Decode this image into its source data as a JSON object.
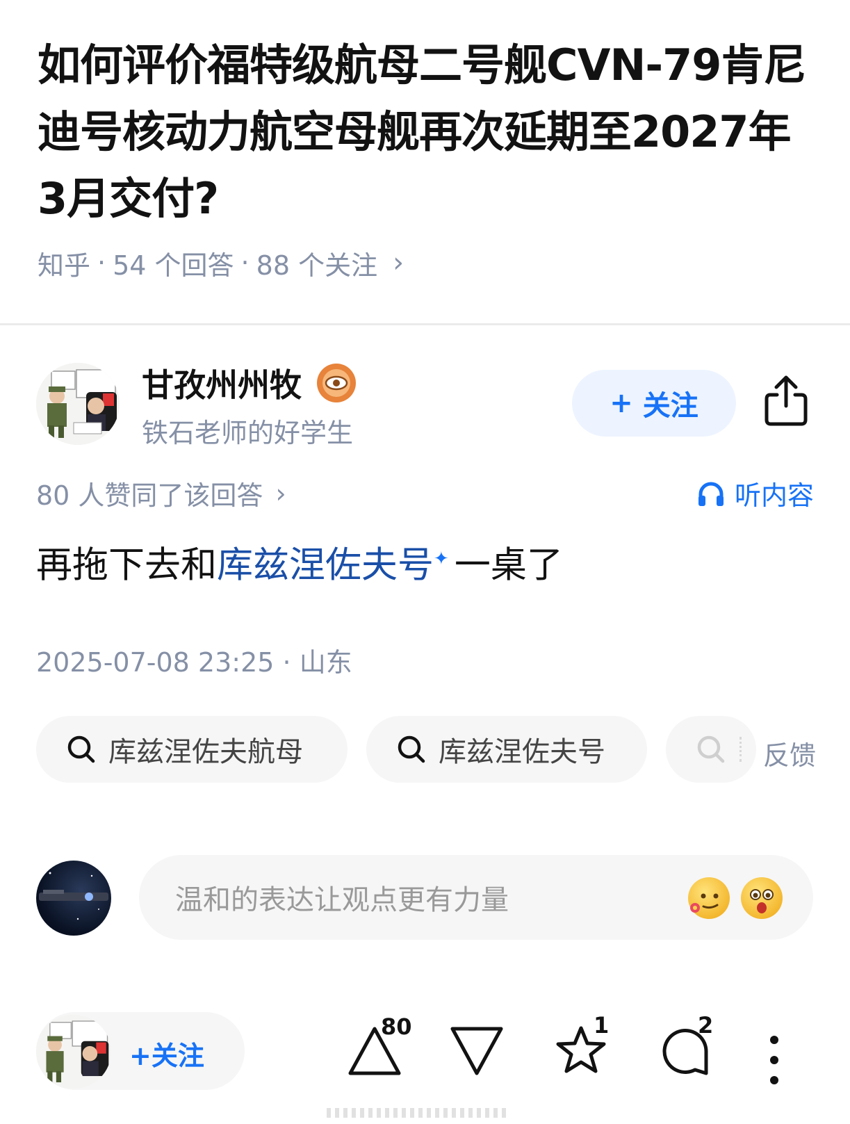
{
  "question": {
    "title": "如何评价福特级航母二号舰CVN-79肯尼迪号核动力航空母舰再次延期至2027年3月交付?",
    "meta": {
      "source": "知乎",
      "answers": "54 个回答",
      "followers": "88 个关注",
      "separator": "·",
      "chevron": "›"
    }
  },
  "author": {
    "name": "甘孜州州牧",
    "subtitle": "铁石老师的好学生",
    "follow_label": "关注",
    "follow_plus": "+",
    "avatar_icon": "avatar-cartoon-soldier"
  },
  "answer": {
    "votes_text": "80 人赞同了该回答",
    "votes_chevron": "›",
    "listen_label": "听内容",
    "text_before": "再拖下去和",
    "link_text": "库兹涅佐夫号",
    "spark": "✦",
    "text_after": "一桌了",
    "timestamp": "2025-07-08 23:25",
    "location": "山东",
    "separator": "·"
  },
  "search_chips": [
    {
      "label": "库兹涅佐夫航母"
    },
    {
      "label": "库兹涅佐夫号"
    }
  ],
  "feedback_label": "反馈",
  "comment": {
    "placeholder": "温和的表达让观点更有力量",
    "emoji_icons": [
      "flower-emoji-icon",
      "surprised-emoji-icon"
    ]
  },
  "bottom_bar": {
    "follow_label": "关注",
    "follow_plus": "+",
    "upvote_count": "80",
    "favorite_count": "1",
    "comment_count": "2"
  },
  "colors": {
    "accent": "#1772f6",
    "link": "#1a4fa8",
    "muted": "#8590a6",
    "badge": "#e7833a"
  }
}
